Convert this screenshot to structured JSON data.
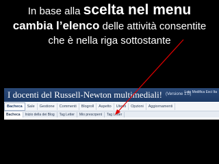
{
  "caption": {
    "part1": "In base alla ",
    "part2": "scelta nel menu",
    "part3": "cambia l’elenco",
    "part4": " delle attività consentite che è nella riga sottostante"
  },
  "banner": {
    "title": "I docenti del Russell-Newton multimediali!",
    "subtitle": "(Versione 1.0)",
    "user": "Lato  Modifica  Esci  Ita"
  },
  "tabs": [
    {
      "label": "Bacheca",
      "active": true
    },
    {
      "label": "Sale"
    },
    {
      "label": "Gestione"
    },
    {
      "label": "Commenti"
    },
    {
      "label": "Blogroll"
    },
    {
      "label": "Aspetto"
    },
    {
      "label": "Utenti"
    },
    {
      "label": "Opzioni"
    },
    {
      "label": "Aggiornamenti"
    }
  ],
  "subtabs": [
    {
      "label": "Bacheca",
      "active": true
    },
    {
      "label": "Inizio della dei Blog"
    },
    {
      "label": "Tag Letter"
    },
    {
      "label": "Mio prescrpent"
    },
    {
      "label": "Tag Letter"
    }
  ],
  "colors": {
    "arrow": "#e00000",
    "banner": "#1d3a66"
  }
}
